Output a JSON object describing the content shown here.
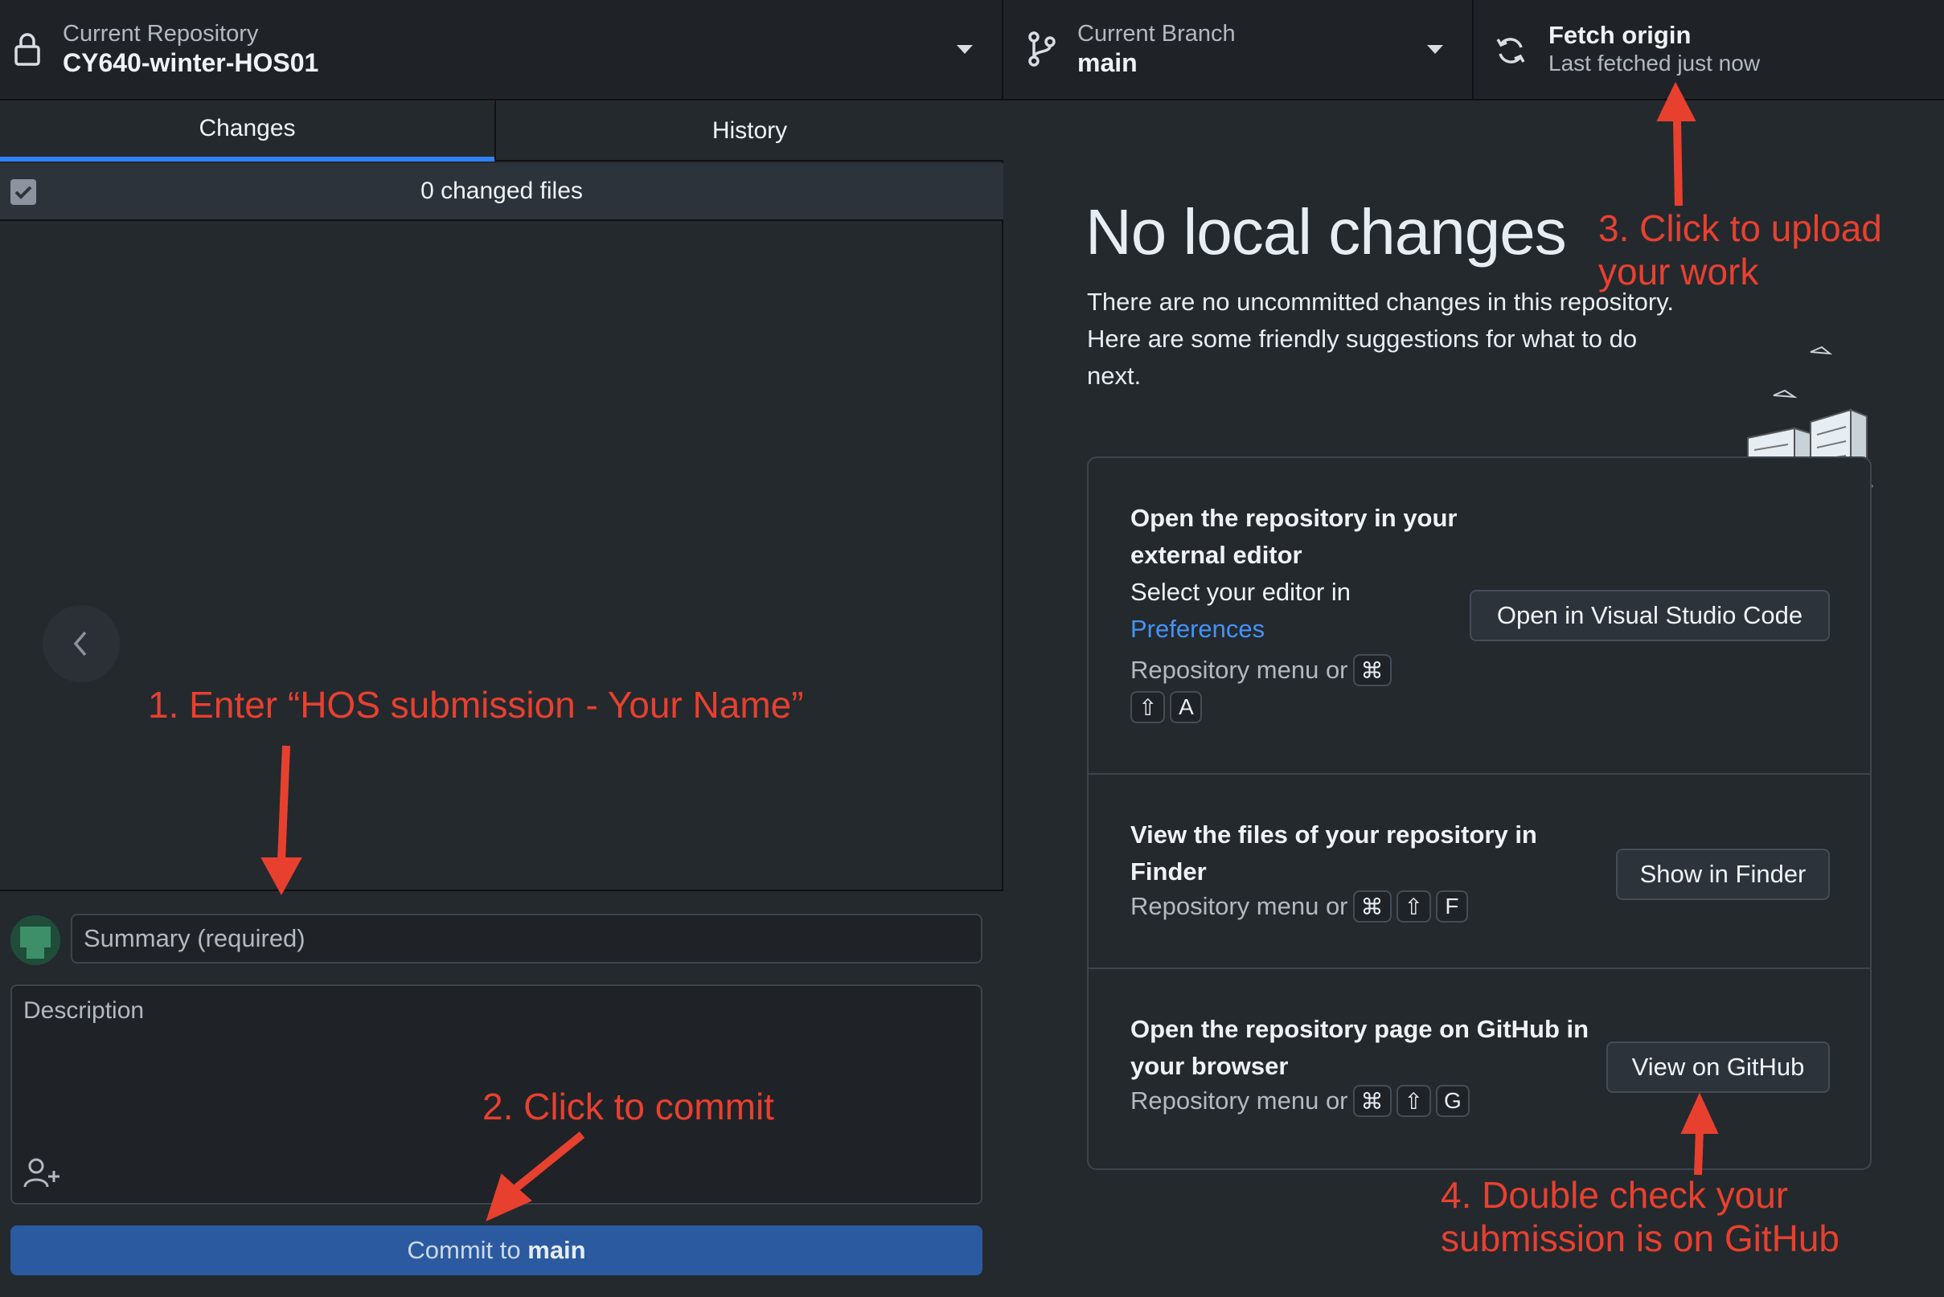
{
  "toolbar": {
    "repository": {
      "label": "Current Repository",
      "value": "CY640-winter-HOS01"
    },
    "branch": {
      "label": "Current Branch",
      "value": "main"
    },
    "fetch": {
      "label": "Fetch origin",
      "status": "Last fetched just now"
    }
  },
  "left": {
    "tabs": [
      {
        "label": "Changes",
        "active": true
      },
      {
        "label": "History",
        "active": false
      }
    ],
    "changed_files": "0 changed files",
    "commit": {
      "summary_placeholder": "Summary (required)",
      "description_placeholder": "Description",
      "button_prefix": "Commit to ",
      "button_branch": "main"
    }
  },
  "right": {
    "title": "No local changes",
    "subtitle": "There are no uncommitted changes in this repository. Here are some friendly suggestions for what to do next.",
    "suggestions": [
      {
        "title": "Open the repository in your external editor",
        "text": "Select your editor in",
        "link": "Preferences",
        "shortcut_prefix": "Repository menu or",
        "keys": [
          "⌘",
          "⇧",
          "A"
        ],
        "button": "Open in Visual Studio Code"
      },
      {
        "title": "View the files of your repository in Finder",
        "shortcut_prefix": "Repository menu or",
        "keys": [
          "⌘",
          "⇧",
          "F"
        ],
        "button": "Show in Finder"
      },
      {
        "title": "Open the repository page on GitHub in your browser",
        "shortcut_prefix": "Repository menu or",
        "keys": [
          "⌘",
          "⇧",
          "G"
        ],
        "button": "View on GitHub"
      }
    ]
  },
  "annotations": {
    "step1": "1. Enter “HOS submission - Your Name”",
    "step2": "2. Click to commit",
    "step3_line1": "3. Click to upload",
    "step3_line2": "your work",
    "step4_line1": "4. Double check your",
    "step4_line2": "submission is on GitHub",
    "color": "#e8402f"
  },
  "icons": [
    "lock-icon",
    "branch-icon",
    "chevron-down-icon",
    "sync-icon",
    "chevron-left-icon",
    "person-add-icon",
    "avatar",
    "empty-state-illustration"
  ],
  "colors": {
    "accent": "#2f81f7",
    "commit_button": "#2c5aa0",
    "link": "#4493f8",
    "background": "#24292e"
  }
}
